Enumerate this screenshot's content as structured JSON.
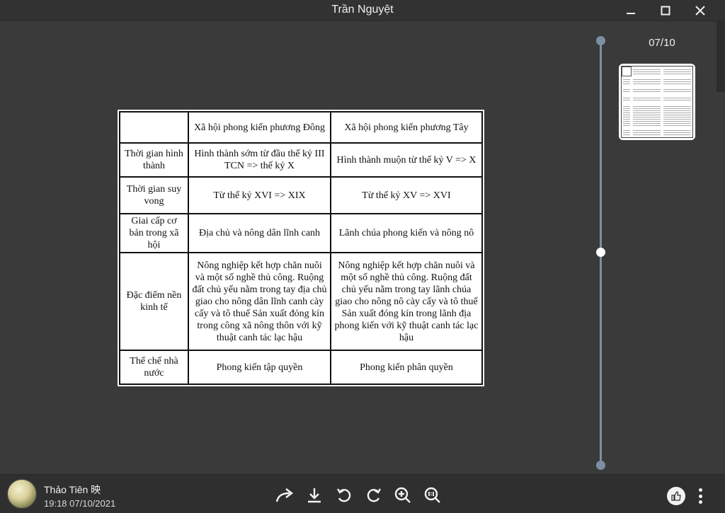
{
  "window": {
    "title": "Trần Nguyệt",
    "minimize_icon": "minimize-icon",
    "maximize_icon": "maximize-icon",
    "close_icon": "close-icon"
  },
  "viewer": {
    "page_counter": "07/10",
    "slider_position_fraction": 0.5
  },
  "document_table": {
    "header": [
      "",
      "Xã hội phong kiến phương Đông",
      "Xã hội phong kiến phương Tây"
    ],
    "rows": [
      [
        "Thời gian hình thành",
        "Hình thành sớm từ đầu thế kỷ III TCN => thế kỷ X",
        "Hình thành muộn từ thế kỷ V => X"
      ],
      [
        "Thời gian suy vong",
        "Từ thế kỷ XVI => XIX",
        "Từ thế kỷ XV => XVI"
      ],
      [
        "Giai cấp cơ bản trong xã hội",
        "Địa chủ và nông dân lĩnh canh",
        "Lãnh chúa phong kiến và nông nô"
      ],
      [
        "Đặc điểm nền kinh tế",
        "Nông nghiệp kết hợp chăn nuôi và một số nghề thủ công. Ruộng đất chủ yếu nằm trong tay địa chủ giao cho nông dân lĩnh canh cày cấy và tô thuế Sản xuất đóng kín trong công xã nông thôn với kỹ thuật canh tác lạc hậu",
        "Nông nghiệp kết hợp chăn nuôi và một số nghề thủ công. Ruộng đất chủ yếu nằm trong tay lãnh chúa giao cho nông nô cày cấy và tô thuế Sản xuất đóng kín trong lãnh địa phong kiến với kỹ thuật canh tác lạc hậu"
      ],
      [
        "Thể chế nhà nước",
        "Phong kiến tập quyền",
        "Phong kiến phân quyền"
      ]
    ]
  },
  "footer": {
    "user_name": "Thảo Tiên 映",
    "timestamp": "19:18 07/10/2021",
    "tools": [
      "share-icon",
      "download-icon",
      "rotate-left-icon",
      "rotate-right-icon",
      "zoom-in-icon",
      "actual-size-icon"
    ],
    "like_icon": "thumbs-up-icon",
    "more_icon": "more-vertical-icon"
  },
  "colors": {
    "background": "#3a3a3a",
    "titlebar": "#323232",
    "bottombar": "#2f2f2f",
    "slider": "#7d8fa3"
  }
}
